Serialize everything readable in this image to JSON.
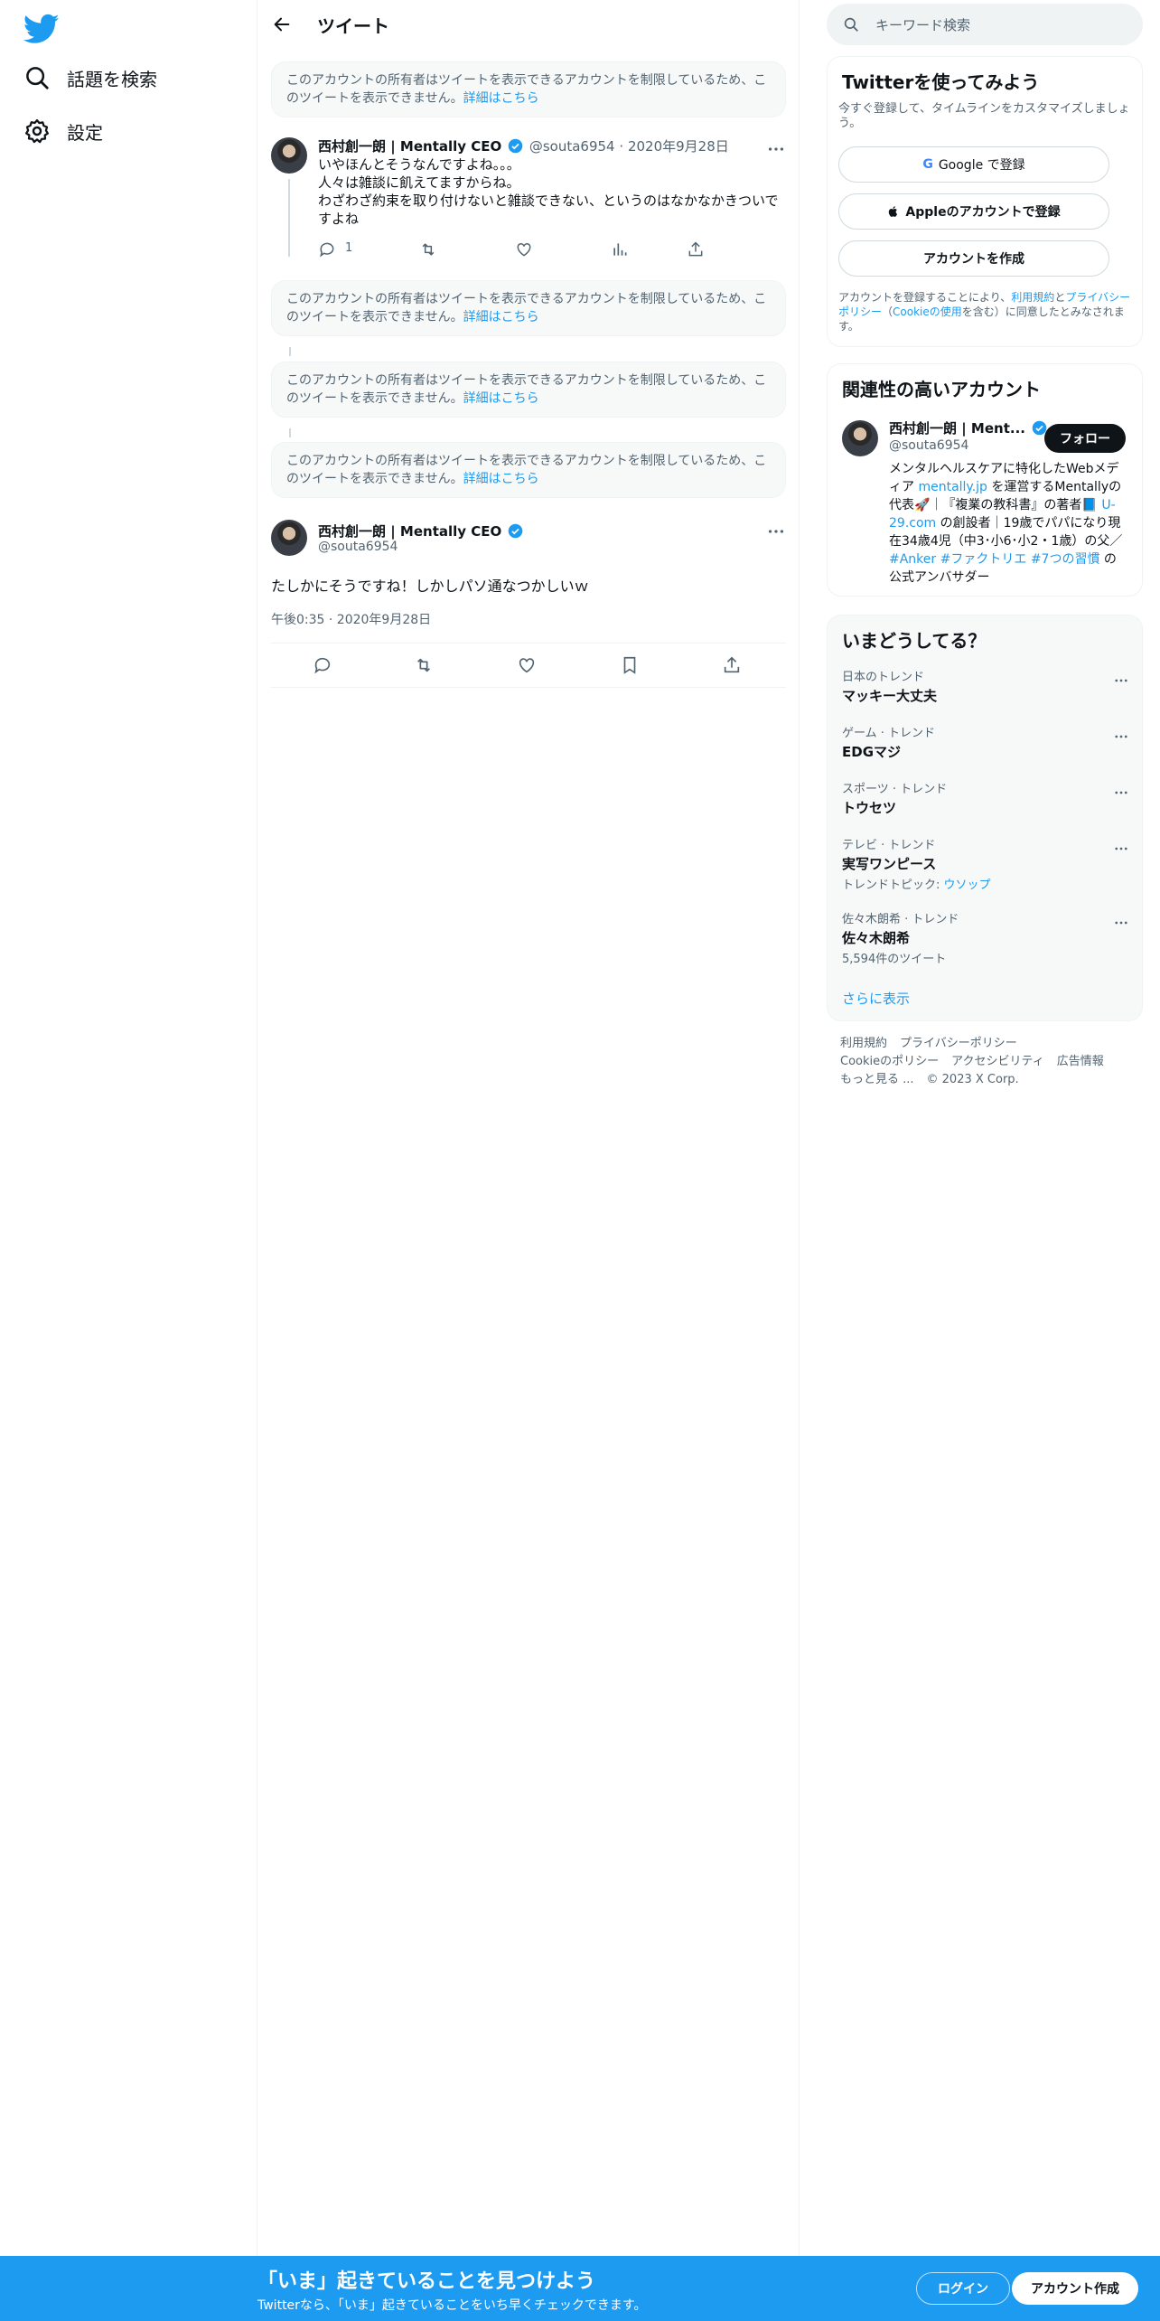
{
  "colors": {
    "accent": "#1d9bf0",
    "text": "#0f1419",
    "muted": "#536471"
  },
  "nav": {
    "items": [
      {
        "label": "話題を検索",
        "icon": "search-icon"
      },
      {
        "label": "設定",
        "icon": "gear-icon"
      }
    ]
  },
  "header": {
    "title": "ツイート"
  },
  "notices": {
    "text": "このアカウントの所有者はツイートを表示できるアカウントを制限しているため、このツイートを表示できません。",
    "link": "詳細はこちら"
  },
  "reply_tweet": {
    "name": "西村創一朗 | Mentally CEO",
    "handle": "@souta6954",
    "date": "2020年9月28日",
    "lines": [
      "いやほんとそうなんですよね。。。",
      "人々は雑談に飢えてますからね。",
      "わざわざ約束を取り付けないと雑談できない、というのはなかなかきついですよね"
    ],
    "reply_count": "1"
  },
  "main_tweet": {
    "name": "西村創一朗 | Mentally CEO",
    "handle": "@souta6954",
    "text": "たしかにそうですね！しかしパソ通なつかしいｗ",
    "timestamp": "午後0:35 · 2020年9月28日"
  },
  "search": {
    "placeholder": "キーワード検索"
  },
  "signup": {
    "title": "Twitterを使ってみよう",
    "subtitle": "今すぐ登録して、タイムラインをカスタマイズしましょう。",
    "google": "Google で登録",
    "apple": "Appleのアカウントで登録",
    "create": "アカウントを作成",
    "legal_pre": "アカウントを登録することにより、",
    "legal_terms": "利用規約",
    "legal_and": "と",
    "legal_privacy": "プライバシーポリシー",
    "legal_paren_open": "（",
    "legal_cookie": "Cookieの使用",
    "legal_post": "を含む）に同意したとみなされます。"
  },
  "related": {
    "title": "関連性の高いアカウント",
    "name": "西村創一朗 | Ment...",
    "handle": "@souta6954",
    "follow": "フォロー",
    "bio": {
      "p1": "メンタルヘルスケアに特化したWebメディア ",
      "l1": "mentally.jp",
      "p2": " を運営するMentallyの代表🚀｜『複業の教科書』の著者📘 ",
      "l2": "U-29.com",
      "p3": " の創設者｜19歳でパパになり現在34歳4児（中3･小6･小2・1歳）の父／ ",
      "l3": "#Anker",
      "sp": " ",
      "l4": "#ファクトリエ",
      "l5": "#7つの習慣",
      "p4": " の公式アンバサダー"
    }
  },
  "trends": {
    "title": "いまどうしてる？",
    "items": [
      {
        "category": "日本のトレンド",
        "title": "マッキー大丈夫"
      },
      {
        "category": "ゲーム · トレンド",
        "title": "EDGマジ"
      },
      {
        "category": "スポーツ · トレンド",
        "title": "トウセツ"
      },
      {
        "category": "テレビ · トレンド",
        "title": "実写ワンピース",
        "sub_label": "トレンドトピック: ",
        "sub_link": "ウソップ"
      },
      {
        "category": "佐々木朗希 · トレンド",
        "title": "佐々木朗希",
        "sub": "5,594件のツイート"
      }
    ],
    "more": "さらに表示"
  },
  "footer": {
    "links": [
      "利用規約",
      "プライバシーポリシー",
      "Cookieのポリシー",
      "アクセシビリティ",
      "広告情報",
      "もっと見る ..."
    ],
    "copyright": "© 2023 X Corp."
  },
  "banner": {
    "title": "「いま」起きていることを見つけよう",
    "subtitle": "Twitterなら、「いま」起きていることをいち早くチェックできます。",
    "login": "ログイン",
    "signup": "アカウント作成"
  }
}
